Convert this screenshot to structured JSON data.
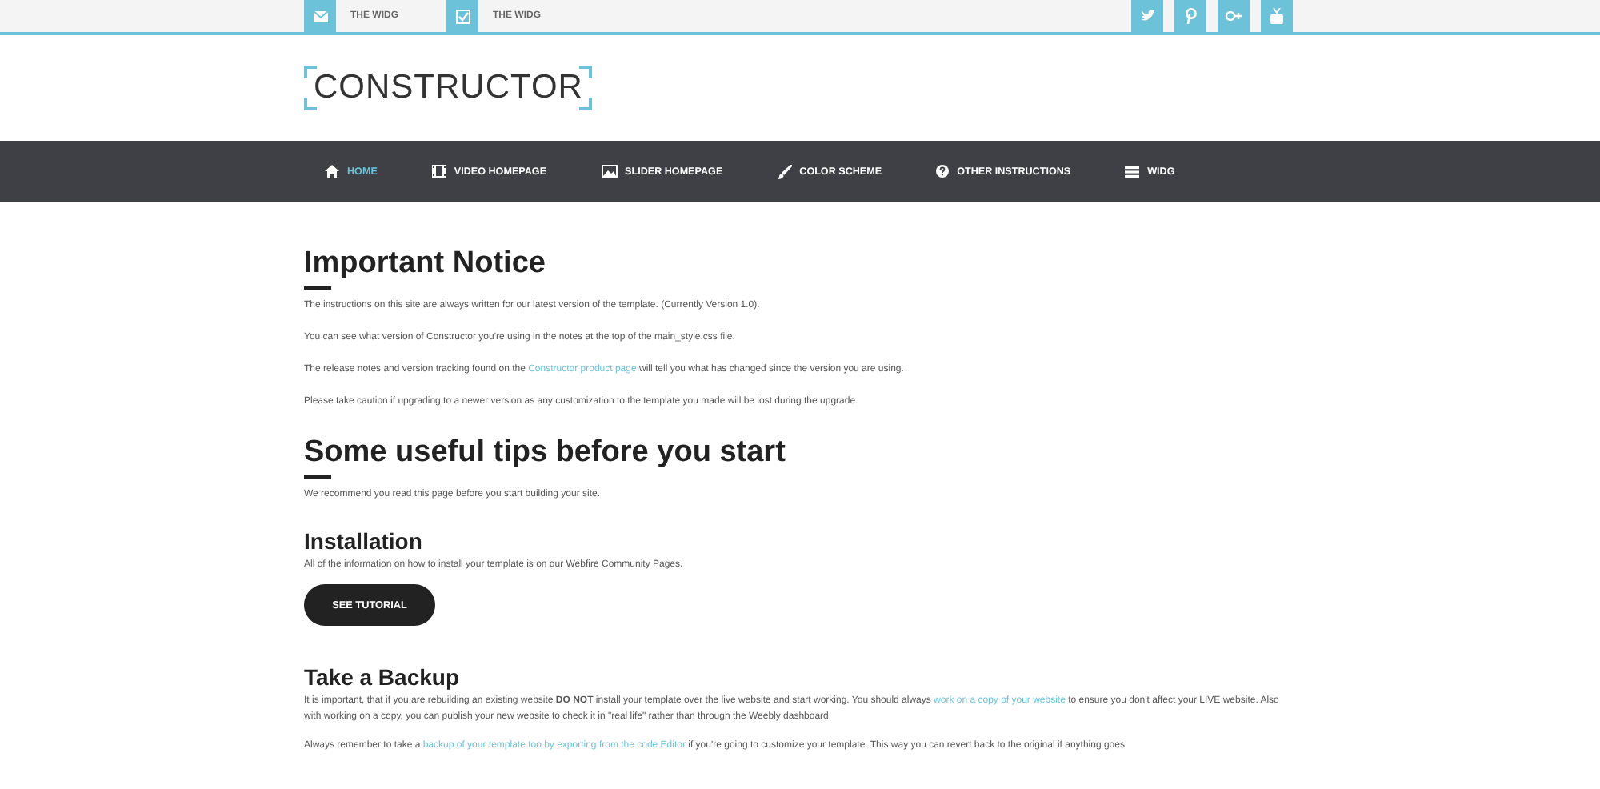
{
  "top_bar": {
    "contacts": [
      {
        "kind": "mail",
        "label": "THE WIDG"
      },
      {
        "kind": "check",
        "label": "THE WIDG"
      }
    ],
    "social": [
      {
        "kind": "bird"
      },
      {
        "kind": "pin"
      },
      {
        "kind": "plus"
      },
      {
        "kind": "video"
      }
    ]
  },
  "logo": "CONSTRUCTOR",
  "nav": [
    {
      "kind": "home",
      "label": "HOME",
      "selected": true
    },
    {
      "kind": "film",
      "label": "VIDEO HOMEPAGE",
      "selected": false
    },
    {
      "kind": "image",
      "label": "SLIDER HOMEPAGE",
      "selected": false
    },
    {
      "kind": "brush",
      "label": "COLOR SCHEME",
      "selected": false
    },
    {
      "kind": "question",
      "label": "OTHER INSTRUCTIONS",
      "selected": false
    },
    {
      "kind": "list",
      "label": "WIDG",
      "selected": false
    }
  ],
  "sections": [
    {
      "kind": "major",
      "title": "Important Notice",
      "paragraphs": [
        {
          "parts": [
            {
              "kind": "text",
              "text": "The instructions on this site are always written for our latest version of the template. (Currently Version 1.0)."
            }
          ]
        },
        {
          "parts": [
            {
              "kind": "text",
              "text": "You can see what version of Constructor you're using in the notes at the top of the main_style.css file."
            }
          ]
        },
        {
          "parts": [
            {
              "kind": "text",
              "text": "The release notes and version tracking found on the "
            },
            {
              "kind": "link",
              "text": "Constructor product page"
            },
            {
              "kind": "text",
              "text": " will tell you what has changed since the version you are using."
            }
          ]
        },
        {
          "parts": [
            {
              "kind": "text",
              "text": "Please take caution if upgrading to a newer version as any customization to the template you made will be lost during the upgrade."
            }
          ]
        }
      ]
    },
    {
      "kind": "major",
      "title": "Some useful tips before you start",
      "paragraphs": [
        {
          "parts": [
            {
              "kind": "text",
              "text": "We recommend you read this page before you start building your site."
            }
          ]
        }
      ]
    },
    {
      "kind": "minor",
      "title": "Installation",
      "paragraphs": [
        {
          "parts": [
            {
              "kind": "text",
              "text": "All of the information on how to install your template is on our Webfire Community Pages."
            }
          ]
        }
      ],
      "button": "SEE TUTORIAL"
    },
    {
      "kind": "minor",
      "title": "Take a Backup",
      "paragraphs": [
        {
          "parts": [
            {
              "kind": "text",
              "text": "It is important, that if you are rebuilding an existing website **DO NOT** install your template over the live website and start working. You should always "
            },
            {
              "kind": "link",
              "text": "work on a copy of your website"
            },
            {
              "kind": "text",
              "text": " to ensure you don't affect your LIVE website. Also with working on a copy, you can publish your new website to check it in \"real life\" rather than through the Weebly dashboard."
            }
          ]
        },
        {
          "parts": [
            {
              "kind": "text",
              "text": "Always remember to take a "
            },
            {
              "kind": "link",
              "text": "backup of your template too by exporting from the code Editor"
            },
            {
              "kind": "text",
              "text": " if you're going to customize your template. This way you can revert back to the original if anything goes"
            }
          ]
        }
      ]
    }
  ]
}
